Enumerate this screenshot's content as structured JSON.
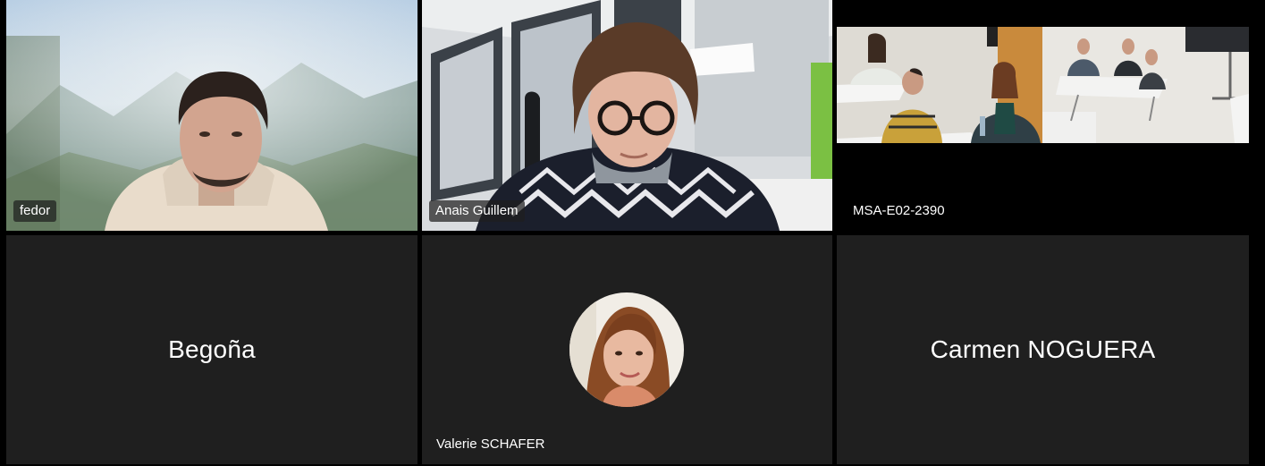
{
  "participants": [
    {
      "id": "fedor",
      "name": "fedor",
      "video": true
    },
    {
      "id": "anais",
      "name": "Anais Guillem",
      "video": true
    },
    {
      "id": "room",
      "name": "MSA-E02-2390",
      "video": true
    },
    {
      "id": "begona",
      "name": "Begoña",
      "video": false
    },
    {
      "id": "valerie",
      "name": "Valerie SCHAFER",
      "video": false,
      "avatar": "photo-avatar"
    },
    {
      "id": "carmen",
      "name": "Carmen NOGUERA",
      "video": false
    }
  ],
  "colors": {
    "background": "#000000",
    "tile": "#1f1f1f",
    "name_text": "#ffffff"
  }
}
